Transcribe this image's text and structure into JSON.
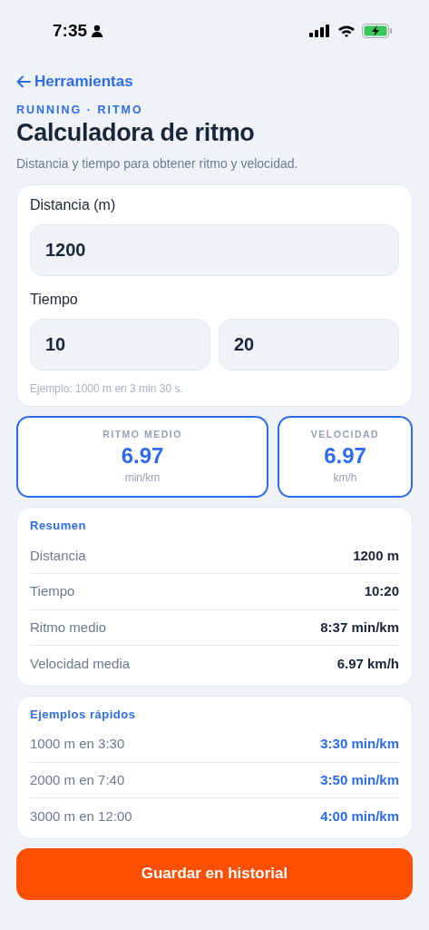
{
  "status_bar": {
    "time": "7:35"
  },
  "back_link": {
    "label": "Herramientas"
  },
  "eyebrow": "RUNNING · RITMO",
  "title": "Calculadora de ritmo",
  "subtitle": "Distancia y tiempo para obtener ritmo y velocidad.",
  "form": {
    "distance": {
      "label": "Distancia (m)",
      "value": "1200"
    },
    "time": {
      "label": "Tiempo",
      "minutes": "10",
      "seconds": "20"
    },
    "hint": "Ejemplo: 1000 m en 3 min 30 s."
  },
  "metrics": [
    {
      "label": "RITMO MEDIO",
      "value": "6.97",
      "unit": "min/km"
    },
    {
      "label": "VELOCIDAD",
      "value": "6.97",
      "unit": "km/h"
    }
  ],
  "summary": {
    "title": "Resumen",
    "rows": [
      {
        "label": "Distancia",
        "value": "1200 m"
      },
      {
        "label": "Tiempo",
        "value": "10:20"
      },
      {
        "label": "Ritmo medio",
        "value": "8:37 min/km"
      },
      {
        "label": "Velocidad media",
        "value": "6.97 km/h"
      }
    ]
  },
  "examples": {
    "title": "Ejemplos rápidos",
    "rows": [
      {
        "label": "1000 m en 3:30",
        "value": "3:30 min/km"
      },
      {
        "label": "2000 m en 7:40",
        "value": "3:50 min/km"
      },
      {
        "label": "3000 m en 12:00",
        "value": "4:00 min/km"
      }
    ]
  },
  "save_button": "Guardar en historial"
}
